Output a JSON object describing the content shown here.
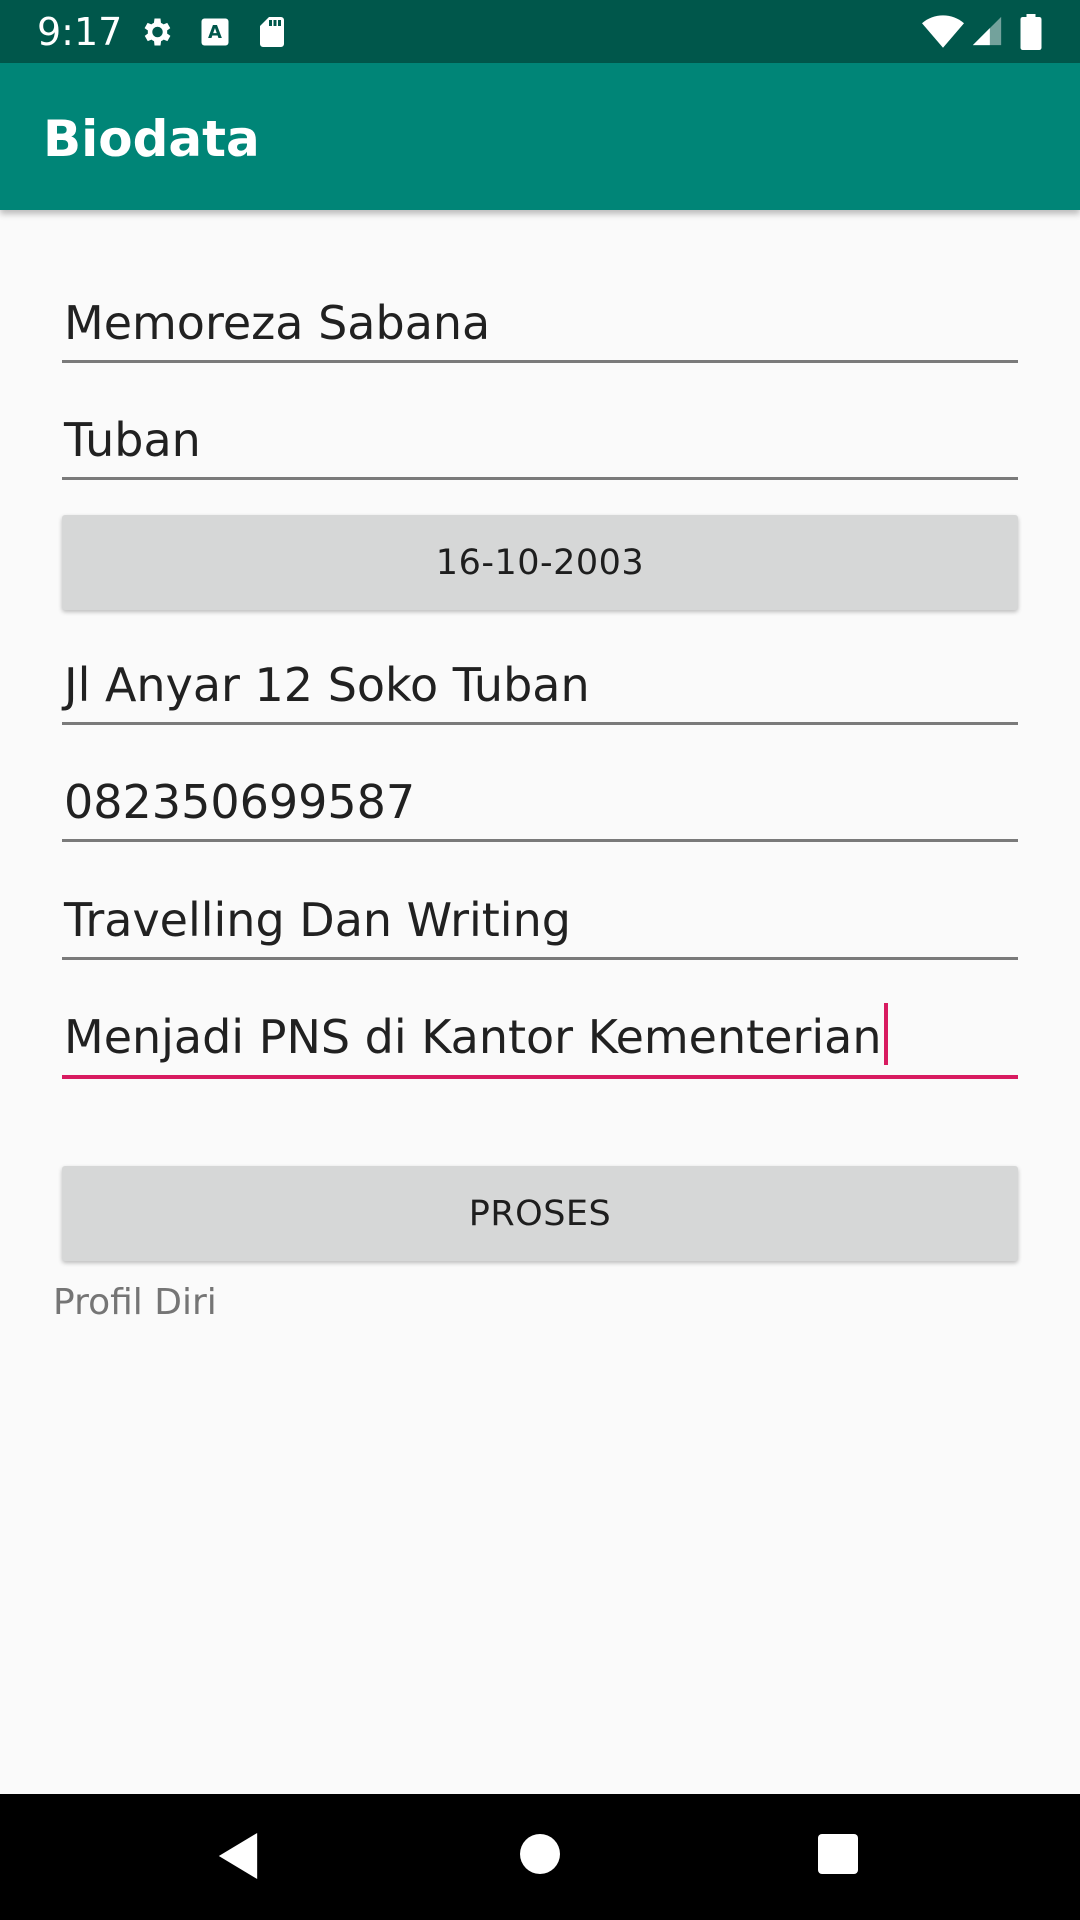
{
  "status_bar": {
    "time": "9:17",
    "icons_left": [
      "gear-icon",
      "keyboard-a-icon",
      "sd-card-icon"
    ],
    "icons_right": [
      "wifi-icon",
      "signal-icon",
      "battery-icon"
    ]
  },
  "app_bar": {
    "title": "Biodata",
    "color": "#008577"
  },
  "form": {
    "name": "Memoreza Sabana",
    "birthplace": "Tuban",
    "birthdate_button": "16-10-2003",
    "address": "Jl Anyar 12 Soko Tuban",
    "phone": "082350699587",
    "hobby": "Travelling Dan Writing",
    "goal": "Menjadi PNS di Kantor Kementerian",
    "submit_button": "PROSES"
  },
  "result": {
    "label": "Profil Diri"
  },
  "colors": {
    "accent": "#d81b60",
    "primary_dark": "#00574b"
  },
  "nav_bar": {
    "buttons": [
      "back-icon",
      "home-icon",
      "recents-icon"
    ]
  }
}
